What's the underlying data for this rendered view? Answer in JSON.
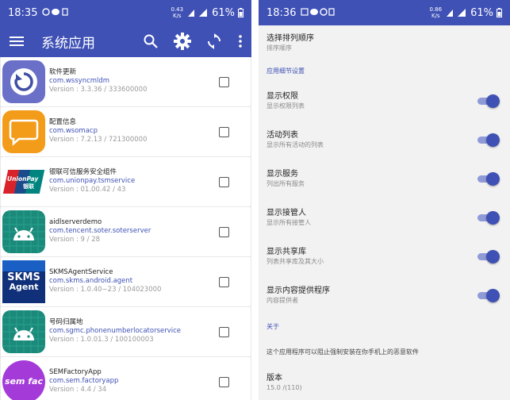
{
  "left": {
    "status": {
      "time": "18:35",
      "speed_top": "0.43",
      "speed_unit": "K/s",
      "battery": "61%"
    },
    "toolbar": {
      "title": "系统应用",
      "menu_icon": "menu-icon",
      "search_icon": "search-icon",
      "settings_icon": "gear-icon",
      "refresh_icon": "refresh-icon",
      "more_icon": "more-vert-icon"
    },
    "apps": [
      {
        "name": "软件更新",
        "package": "com.wssyncmldm",
        "version": "Version : 3.3.36 / 333600000",
        "icon": "software-update-icon",
        "checked": false
      },
      {
        "name": "配置信息",
        "package": "com.wsomacp",
        "version": "Version : 7.2.13 / 721300000",
        "icon": "message-icon",
        "checked": false
      },
      {
        "name": "银联可信服务安全组件",
        "package": "com.unionpay.tsmservice",
        "version": "Version : 01.00.42 / 43",
        "icon": "unionpay-icon",
        "checked": false
      },
      {
        "name": "aidlserverdemo",
        "package": "com.tencent.soter.soterserver",
        "version": "Version : 9 / 28",
        "icon": "android-icon",
        "checked": false
      },
      {
        "name": "SKMSAgentService",
        "package": "com.skms.android.agent",
        "version": "Version : 1.0.40−23 / 104023000",
        "icon": "skms-agent-icon",
        "checked": false
      },
      {
        "name": "号码归属地",
        "package": "com.sgmc.phonenumberlocatorservice",
        "version": "Version : 1.0.01.3 / 100100003",
        "icon": "android-icon",
        "checked": false
      },
      {
        "name": "SEMFactoryApp",
        "package": "com.sem.factoryapp",
        "version": "Version : 4.4 / 34",
        "icon": "sem-factory-icon",
        "checked": false
      }
    ],
    "unionpay_text": {
      "en": "UnionPay",
      "cn": "银联"
    },
    "skms_text": {
      "line1": "SKMS",
      "line2": "Agent"
    },
    "sem_text": "sem fac"
  },
  "right": {
    "status": {
      "time": "18:36",
      "speed_top": "0.86",
      "speed_unit": "K/s",
      "battery": "61%"
    },
    "sort": {
      "title": "选择排列顺序",
      "summary": "排序顺序"
    },
    "category_details": "应用细节设置",
    "prefs": [
      {
        "title": "显示权限",
        "summary": "显示权限列表",
        "on": true
      },
      {
        "title": "活动列表",
        "summary": "显示所有活动的列表",
        "on": true
      },
      {
        "title": "显示服务",
        "summary": "列出所有服务",
        "on": true
      },
      {
        "title": "显示接管人",
        "summary": "显示所有接管人",
        "on": true
      },
      {
        "title": "显示共享库",
        "summary": "列表共享库及其大小",
        "on": true
      },
      {
        "title": "显示内容提供程序",
        "summary": "内容提供者",
        "on": true
      }
    ],
    "category_about": "关于",
    "about_text": "这个应用程序可以阻止强制安装在你手机上的恶意软件",
    "version": {
      "title": "版本",
      "summary": "15.0 /(110)"
    }
  },
  "colors": {
    "primary": "#3f51b5",
    "switch_track": "#8f9bd6",
    "package_text": "#3f51b5"
  }
}
